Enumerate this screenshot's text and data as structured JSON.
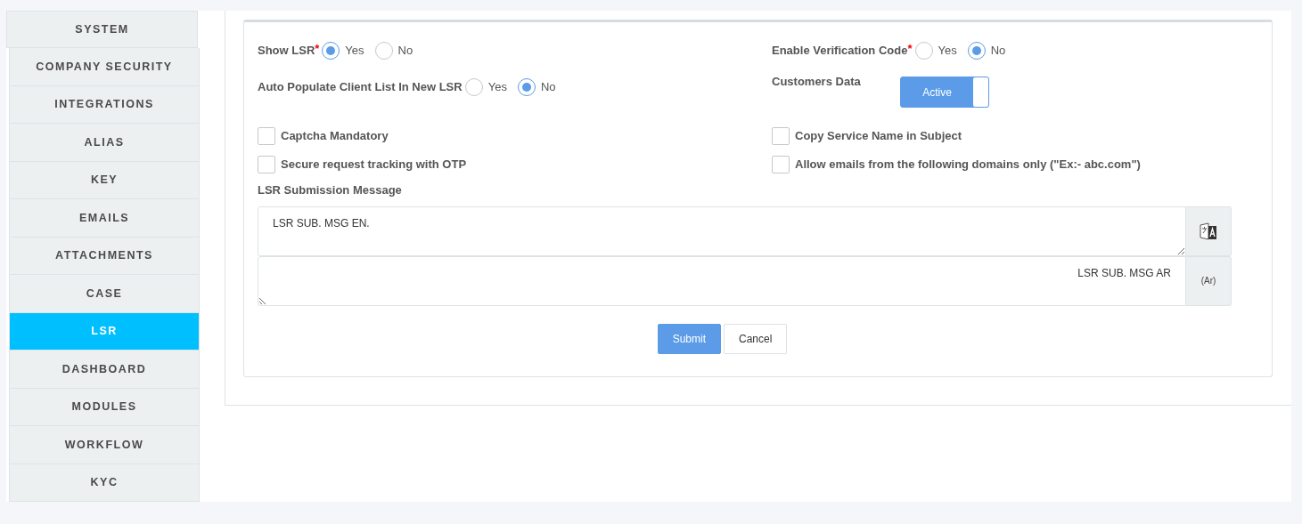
{
  "sidebar": {
    "items": [
      {
        "label": "SYSTEM",
        "selected": false
      },
      {
        "label": "COMPANY SECURITY",
        "selected": false
      },
      {
        "label": "INTEGRATIONS",
        "selected": false
      },
      {
        "label": "ALIAS",
        "selected": false
      },
      {
        "label": "KEY",
        "selected": false
      },
      {
        "label": "EMAILS",
        "selected": false
      },
      {
        "label": "ATTACHMENTS",
        "selected": false
      },
      {
        "label": "CASE",
        "selected": false
      },
      {
        "label": "LSR",
        "selected": true
      },
      {
        "label": "DASHBOARD",
        "selected": false
      },
      {
        "label": "MODULES",
        "selected": false
      },
      {
        "label": "WORKFLOW",
        "selected": false
      },
      {
        "label": "KYC",
        "selected": false
      }
    ]
  },
  "form": {
    "rows": [
      {
        "left": {
          "kind": "radio",
          "label": "Show LSR",
          "required_mark": "*",
          "options": [
            {
              "label": "Yes",
              "selected": true
            },
            {
              "label": "No",
              "selected": false
            }
          ]
        },
        "right": {
          "kind": "radio",
          "label": "Enable Verification Code",
          "required_mark": "*",
          "options": [
            {
              "label": "Yes",
              "selected": false
            },
            {
              "label": "No",
              "selected": true
            }
          ]
        }
      },
      {
        "left": {
          "kind": "radio",
          "label": "Auto Populate Client List In New LSR",
          "options": [
            {
              "label": "Yes",
              "selected": false
            },
            {
              "label": "No",
              "selected": true
            }
          ]
        },
        "right": {
          "kind": "toggle",
          "label": "Customers Data",
          "value": "Active",
          "on": true
        }
      }
    ],
    "checkboxes": [
      {
        "label": "Captcha Mandatory",
        "checked": false
      },
      {
        "label": "Copy Service Name in Subject",
        "checked": false
      },
      {
        "label": "Secure request tracking with OTP",
        "checked": false
      },
      {
        "label": "Allow emails from the following domains only (\"Ex:- abc.com\")",
        "checked": false
      }
    ],
    "message_label": "LSR Submission Message",
    "messages": [
      {
        "value": "LSR SUB. MSG EN.",
        "kind": "english",
        "addon": {
          "kind": "icon"
        }
      },
      {
        "value": "LSR SUB. MSG AR",
        "kind": "arabic",
        "addon": {
          "kind": "text",
          "text": "(Ar)"
        }
      }
    ],
    "buttons": [
      {
        "label": "Submit",
        "kind": "primary"
      },
      {
        "label": "Cancel",
        "kind": "secondary"
      }
    ]
  }
}
